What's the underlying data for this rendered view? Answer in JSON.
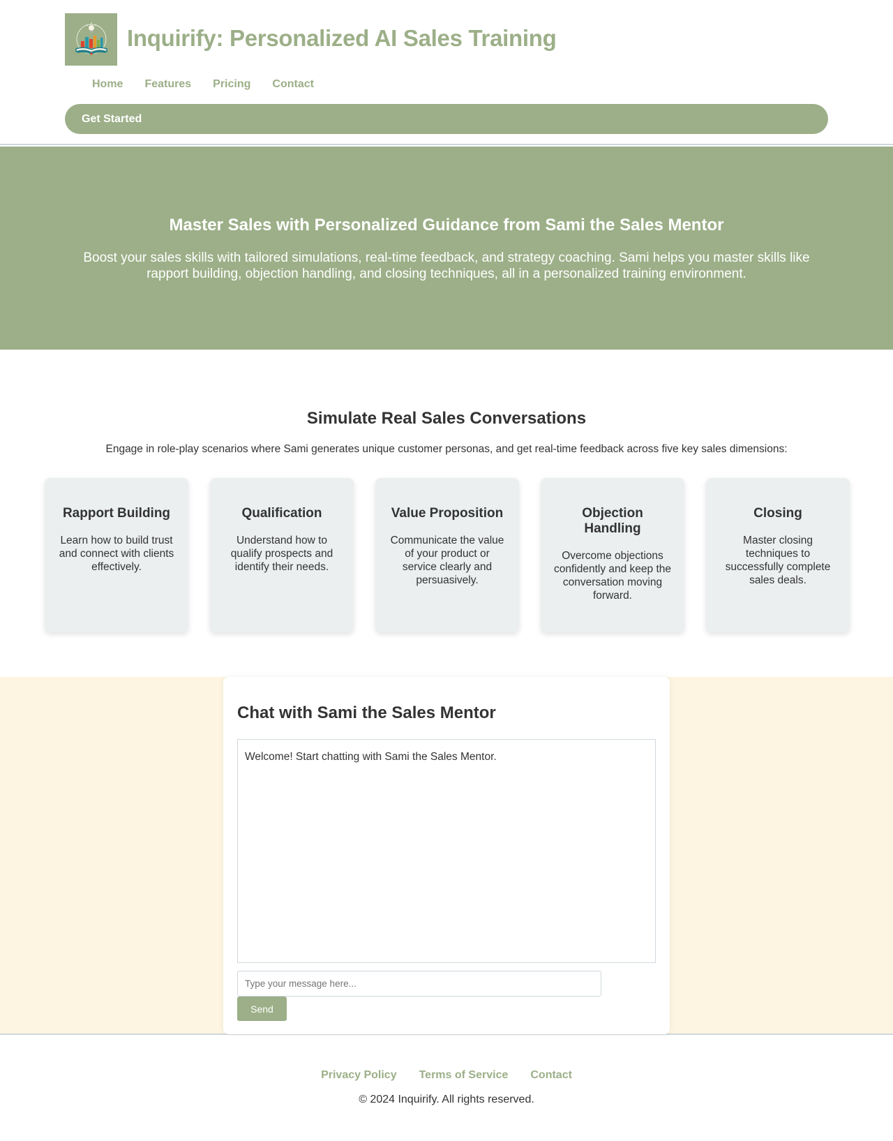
{
  "header": {
    "logo_icon": "book-chart-lightbulb-logo",
    "title": "Inquirify: Personalized AI Sales Training",
    "nav": [
      {
        "label": "Home"
      },
      {
        "label": "Features"
      },
      {
        "label": "Pricing"
      },
      {
        "label": "Contact"
      }
    ],
    "cta_label": "Get Started"
  },
  "hero": {
    "title": "Master Sales with Personalized Guidance from Sami the Sales Mentor",
    "description": "Boost your sales skills with tailored simulations, real-time feedback, and strategy coaching. Sami helps you master skills like rapport building, objection handling, and closing techniques, all in a personalized training environment."
  },
  "features": {
    "title": "Simulate Real Sales Conversations",
    "intro": "Engage in role-play scenarios where Sami generates unique customer personas, and get real-time feedback across five key sales dimensions:",
    "cards": [
      {
        "title": "Rapport Building",
        "description": "Learn how to build trust and connect with clients effectively."
      },
      {
        "title": "Qualification",
        "description": "Understand how to qualify prospects and identify their needs."
      },
      {
        "title": "Value Proposition",
        "description": "Communicate the value of your product or service clearly and persuasively."
      },
      {
        "title": "Objection Handling",
        "description": "Overcome objections confidently and keep the conversation moving forward."
      },
      {
        "title": "Closing",
        "description": "Master closing techniques to successfully complete sales deals."
      }
    ]
  },
  "chat": {
    "title": "Chat with Sami the Sales Mentor",
    "welcome_message": "Welcome! Start chatting with Sami the Sales Mentor.",
    "input_value": "",
    "input_placeholder": "Type your message here...",
    "send_label": "Send"
  },
  "footer": {
    "links": [
      {
        "label": "Privacy Policy"
      },
      {
        "label": "Terms of Service"
      },
      {
        "label": "Contact"
      }
    ],
    "copyright": "© 2024 Inquirify. All rights reserved."
  },
  "colors": {
    "brand": "#9caf88",
    "text": "#333333",
    "card_bg": "#eceff0",
    "chat_section_bg": "#fdf4e1",
    "divider": "#cfd8dc"
  }
}
